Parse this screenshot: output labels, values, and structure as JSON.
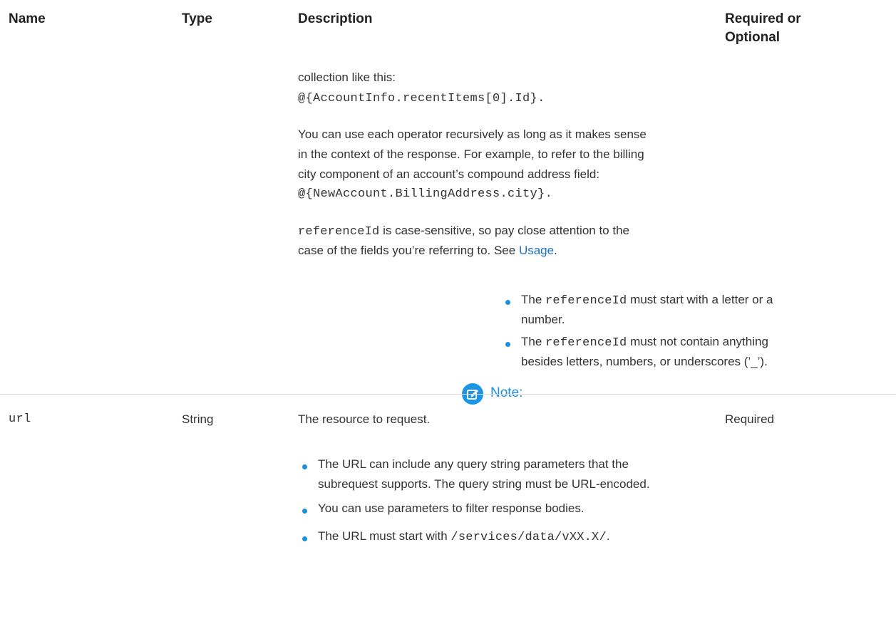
{
  "table": {
    "headers": {
      "name": "Name",
      "type": "Type",
      "description": "Description",
      "required_line1": "Required or",
      "required_line2": "Optional"
    },
    "row1": {
      "desc_line_a": "collection like this:",
      "code_recent": "@{AccountInfo.recentItems[0].Id}",
      "code_recent_tail": ".",
      "p2_line1": "You can use each operator recursively as long as it makes sense",
      "p2_line2": "in the context of the response. For example, to refer to the billing",
      "p2_line3": "city component of an account’s compound address field:",
      "code_billing": "@{NewAccount.BillingAddress.city}",
      "code_billing_tail": ".",
      "p3_code": "referenceId",
      "p3_line1_rest": " is case-sensitive, so pay close attention to the",
      "p3_line2": "case of the fields you’re referring to. See ",
      "p3_link": "Usage",
      "p3_tail": ".",
      "note_label": "Note:",
      "note_items": [
        {
          "pre": "The ",
          "code": "referenceId",
          "post": " must start with a letter or a",
          "line2": "number."
        },
        {
          "pre": "The ",
          "code": "referenceId",
          "post": " must not contain anything",
          "line2": "besides letters, numbers, or underscores (’_’)."
        }
      ]
    },
    "row2": {
      "name": "url",
      "type": "String",
      "desc": "The resource to request.",
      "required": "Required",
      "bullets": [
        {
          "line1": "The URL can include any query string parameters that the",
          "line2": "subrequest supports. The query string must be URL-encoded."
        },
        {
          "line1": "You can use parameters to filter response bodies."
        },
        {
          "pre": "The URL must start with ",
          "code": "/services/data/vXX.X/",
          "post": "."
        }
      ]
    }
  },
  "colors": {
    "accent": "#1b8fdb",
    "link": "#1a73c8",
    "text": "#333333",
    "rule": "#d9d9d9"
  },
  "icons": {
    "note": "note-edit-icon",
    "bullet": "bullet-dot"
  }
}
